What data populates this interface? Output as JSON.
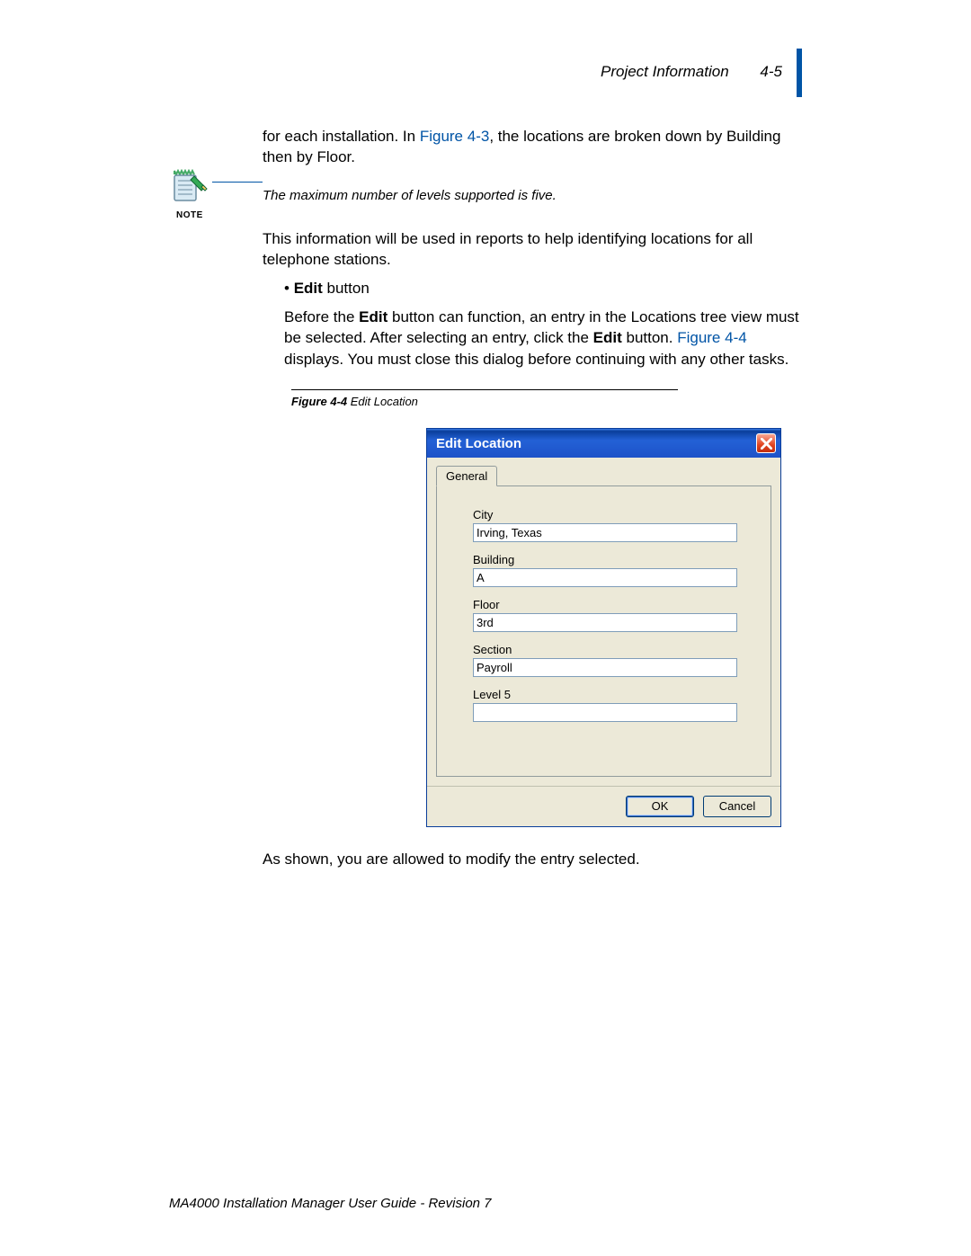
{
  "header": {
    "section": "Project Information",
    "page": "4-5"
  },
  "intro": {
    "prefix": "for each installation. In ",
    "figref": "Figure 4-3",
    "suffix": ", the locations are broken down by Building then by Floor."
  },
  "note": {
    "label": "NOTE",
    "text": "The maximum number of levels supported is five."
  },
  "para2": "This information will be used in reports to help identifying locations for all telephone stations.",
  "bullet": {
    "bold": "Edit",
    "rest": " button"
  },
  "subpara": {
    "t1": "Before the ",
    "b1": "Edit",
    "t2": " button can function, an entry in the Locations tree view must be selected. After selecting an entry, click the ",
    "b2": "Edit",
    "t3": " button. ",
    "figref": "Figure 4-4",
    "t4": " displays. You must close this dialog before continuing with any other tasks."
  },
  "figcaption": {
    "num": "Figure 4-4",
    "title": "  Edit Location"
  },
  "dialog": {
    "title": "Edit Location",
    "tab": "General",
    "fields": {
      "city_label": "City",
      "city_value": "Irving, Texas",
      "building_label": "Building",
      "building_value": "A",
      "floor_label": "Floor",
      "floor_value": "3rd",
      "section_label": "Section",
      "section_value": "Payroll",
      "level5_label": "Level 5",
      "level5_value": ""
    },
    "ok": "OK",
    "cancel": "Cancel"
  },
  "closing": "As shown, you are allowed to modify the entry selected.",
  "footer": "MA4000 Installation Manager User Guide - Revision 7"
}
